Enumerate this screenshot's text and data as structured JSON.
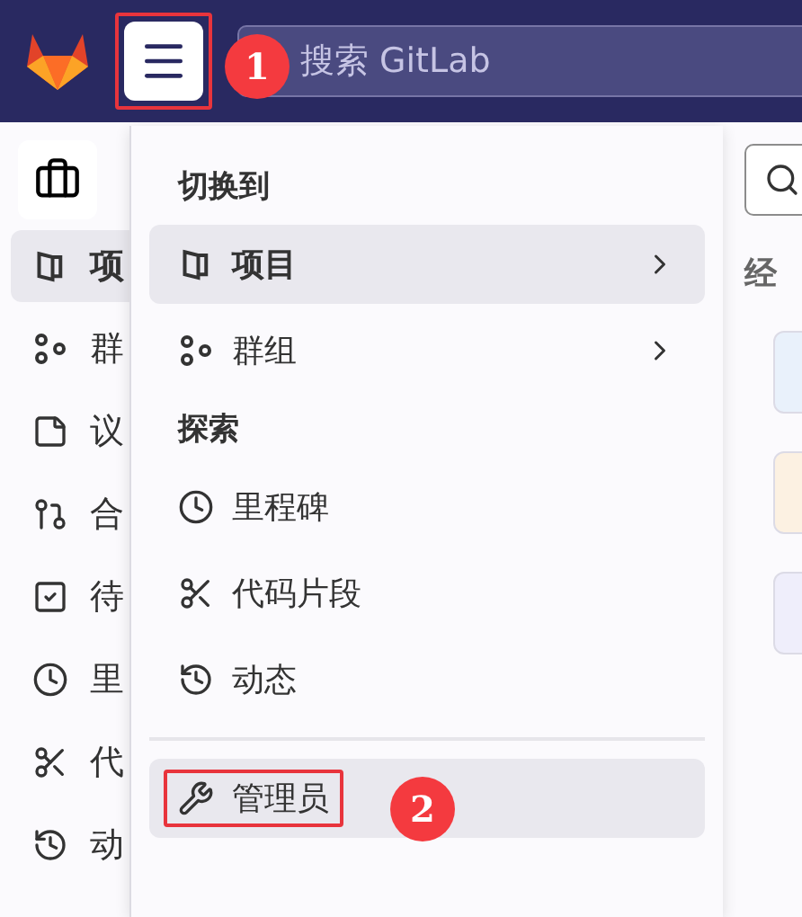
{
  "top_bar": {
    "menu_button": {
      "highlighted": true,
      "badge": "1"
    },
    "search": {
      "placeholder": "搜索 GitLab"
    }
  },
  "sidebar": {
    "items": [
      {
        "label": "项",
        "kind": "project",
        "selected": true
      },
      {
        "label": "群",
        "kind": "group",
        "selected": false
      },
      {
        "label": "议",
        "kind": "issue",
        "selected": false
      },
      {
        "label": "合",
        "kind": "merge",
        "selected": false
      },
      {
        "label": "待",
        "kind": "todo",
        "selected": false
      },
      {
        "label": "里",
        "kind": "milestone",
        "selected": false
      },
      {
        "label": "代",
        "kind": "snippet",
        "selected": false
      },
      {
        "label": "动",
        "kind": "activity",
        "selected": false
      }
    ]
  },
  "dropdown": {
    "sections": [
      {
        "heading": "切换到",
        "items": [
          {
            "label": "项目",
            "kind": "project",
            "selected": true,
            "submenu": true
          },
          {
            "label": "群组",
            "kind": "group",
            "selected": false,
            "submenu": true
          }
        ]
      },
      {
        "heading": "探索",
        "items": [
          {
            "label": "里程碑",
            "kind": "milestone",
            "selected": false,
            "submenu": false
          },
          {
            "label": "代码片段",
            "kind": "snippet",
            "selected": false,
            "submenu": false
          },
          {
            "label": "动态",
            "kind": "activity",
            "selected": false,
            "submenu": false
          }
        ]
      }
    ],
    "footer_items": [
      {
        "label": "管理员",
        "kind": "admin",
        "selected": true,
        "highlighted": true,
        "badge": "2"
      }
    ]
  },
  "content": {
    "heading": "经",
    "cards": [
      {
        "color": "#e9f1fb"
      },
      {
        "color": "#fcf1e2"
      },
      {
        "color": "#efeefb"
      }
    ]
  }
}
